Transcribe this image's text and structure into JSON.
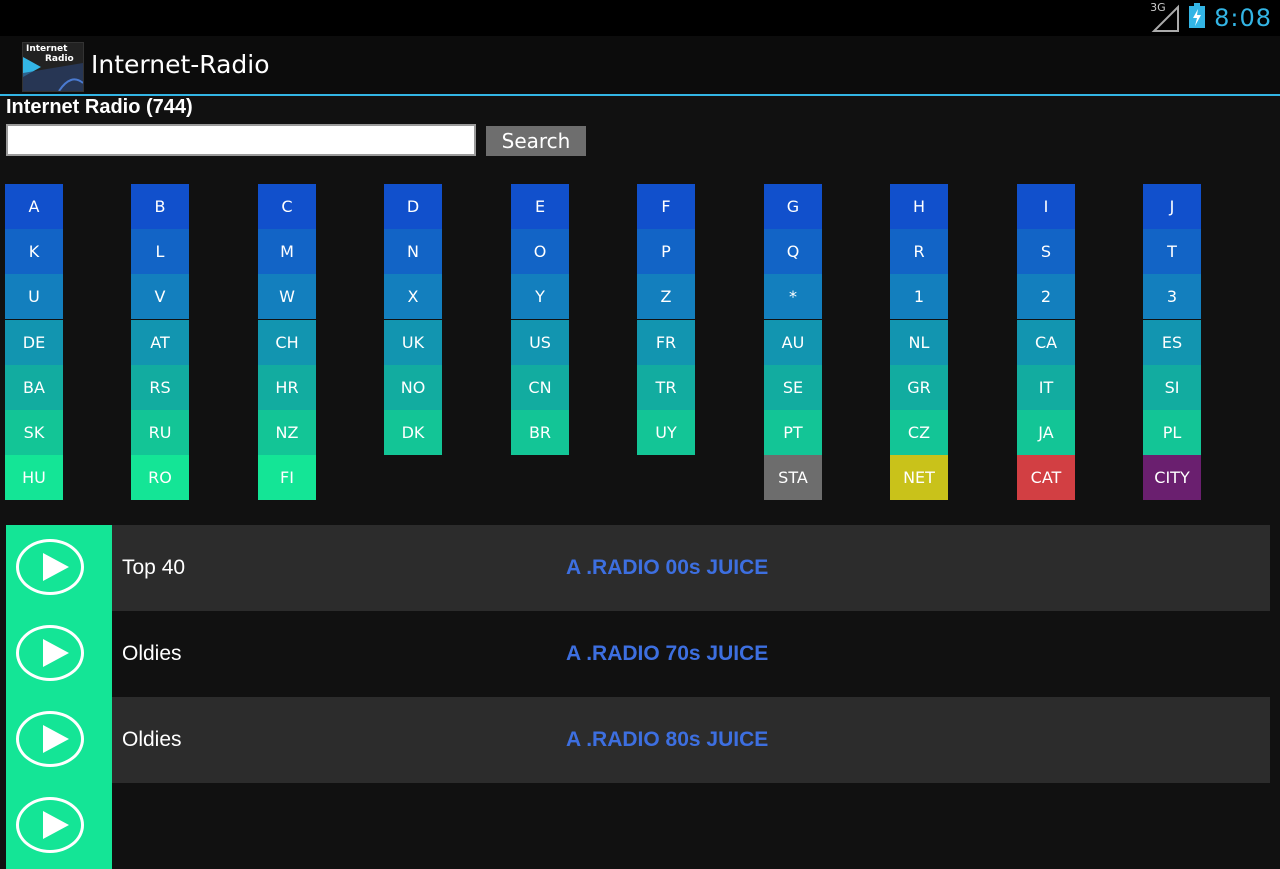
{
  "status_bar": {
    "network": "3G",
    "time": "8:08",
    "icons": [
      "signal-icon",
      "battery-charging-icon"
    ]
  },
  "app": {
    "logo_line1": "Internet",
    "logo_line2": "Radio",
    "title": "Internet-Radio"
  },
  "header": {
    "heading": "Internet Radio (744)",
    "search_value": "",
    "search_label": "Search"
  },
  "grid": {
    "rows": [
      [
        "A",
        "B",
        "C",
        "D",
        "E",
        "F",
        "G",
        "H",
        "I",
        "J"
      ],
      [
        "K",
        "L",
        "M",
        "N",
        "O",
        "P",
        "Q",
        "R",
        "S",
        "T"
      ],
      [
        "U",
        "V",
        "W",
        "X",
        "Y",
        "Z",
        "*",
        "1",
        "2",
        "3"
      ],
      [
        "DE",
        "AT",
        "CH",
        "UK",
        "US",
        "FR",
        "AU",
        "NL",
        "CA",
        "ES"
      ],
      [
        "BA",
        "RS",
        "HR",
        "NO",
        "CN",
        "TR",
        "SE",
        "GR",
        "IT",
        "SI"
      ],
      [
        "SK",
        "RU",
        "NZ",
        "DK",
        "BR",
        "UY",
        "PT",
        "CZ",
        "JA",
        "PL"
      ],
      [
        "HU",
        "RO",
        "FI",
        "",
        "",
        "",
        "STA",
        "NET",
        "CAT",
        "CITY"
      ]
    ],
    "row_colors": [
      "#1150cc",
      "#1264c6",
      "#137fbe",
      "#1295b0",
      "#12aca0",
      "#13c596",
      "#14e596"
    ],
    "special_colors": {
      "STA": "#6d6d6d",
      "NET": "#c9c21a",
      "CAT": "#d23f43",
      "CITY": "#6a1f6f"
    }
  },
  "stations": [
    {
      "genre": "Top 40",
      "name": "A .RADIO 00s JUICE"
    },
    {
      "genre": "Oldies",
      "name": "A .RADIO 70s JUICE"
    },
    {
      "genre": "Oldies",
      "name": "A .RADIO 80s JUICE"
    },
    {
      "genre": "",
      "name": ""
    }
  ],
  "colors": {
    "accent": "#33b5e5",
    "play_bg": "#14e596",
    "station_link": "#3d6fe0",
    "row_alt": "#2c2c2c"
  }
}
